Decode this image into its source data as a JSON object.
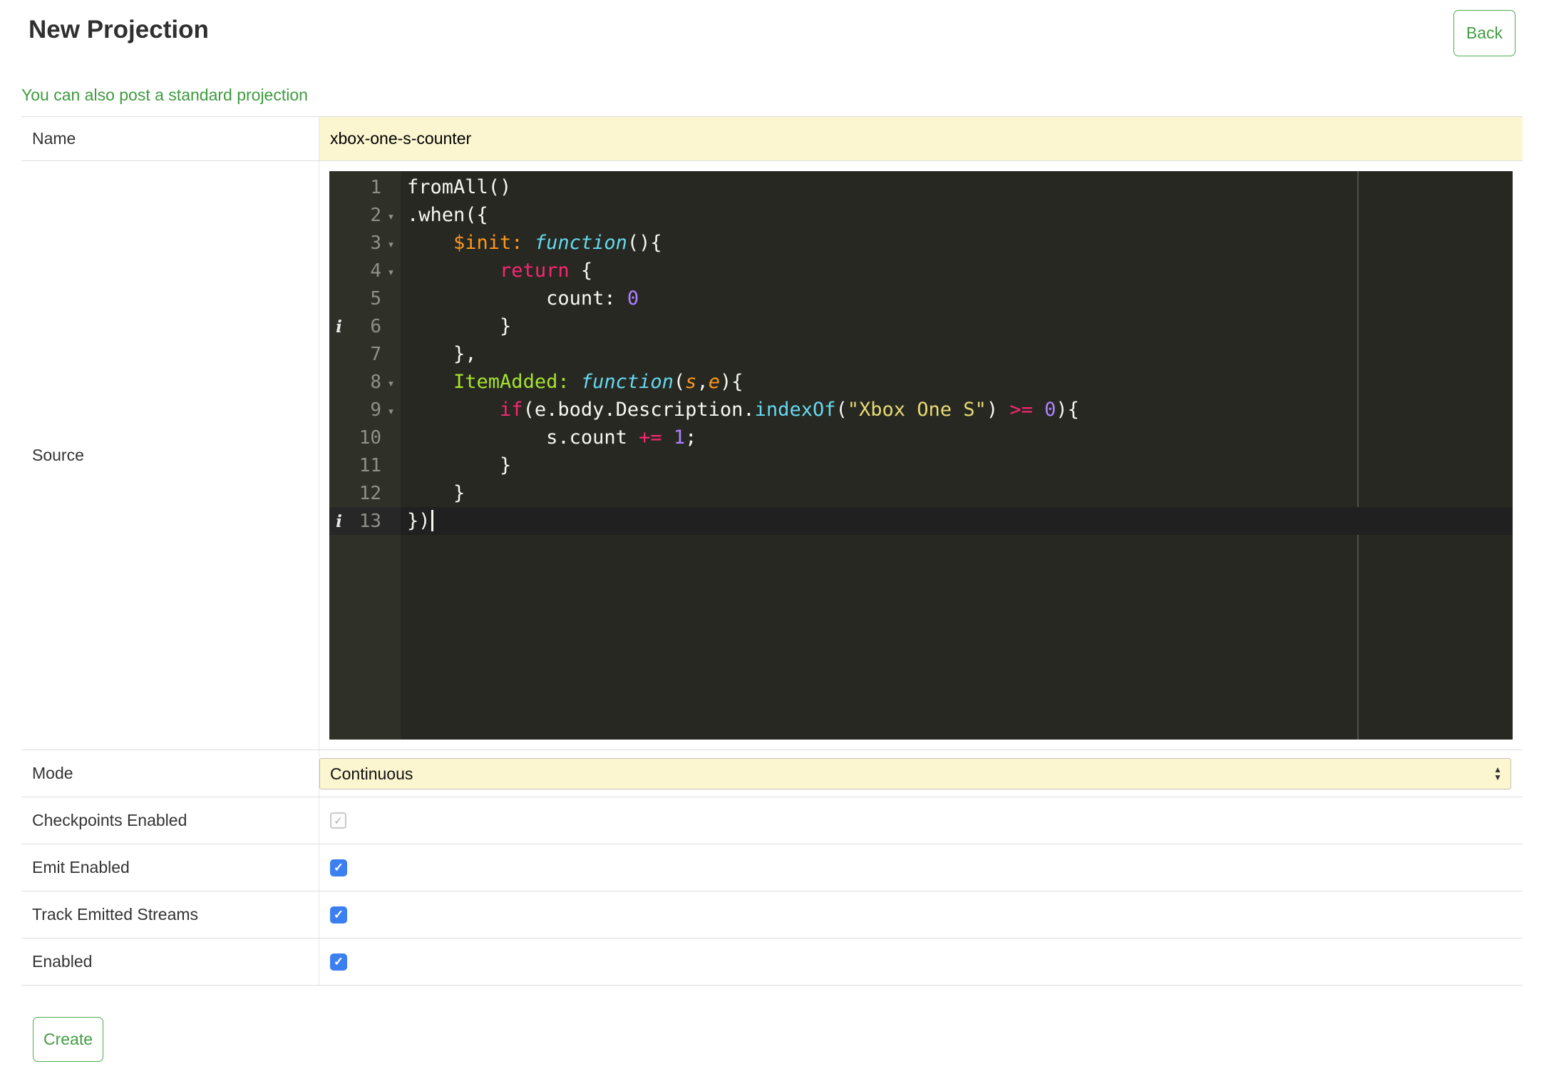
{
  "header": {
    "title": "New Projection",
    "back_label": "Back"
  },
  "link": {
    "text": "You can also post a standard projection"
  },
  "form": {
    "name": {
      "label": "Name",
      "value": "xbox-one-s-counter"
    },
    "source": {
      "label": "Source"
    },
    "mode": {
      "label": "Mode",
      "value": "Continuous"
    },
    "checkpoints": {
      "label": "Checkpoints Enabled",
      "checked": true,
      "disabled": true
    },
    "emit": {
      "label": "Emit Enabled",
      "checked": true,
      "disabled": false
    },
    "track": {
      "label": "Track Emitted Streams",
      "checked": true,
      "disabled": false
    },
    "enabled": {
      "label": "Enabled",
      "checked": true,
      "disabled": false
    },
    "create_label": "Create"
  },
  "colors": {
    "accent_green_text": "#449d44",
    "accent_green_border": "#4cae4c",
    "link_green": "#3e9b3e",
    "field_yellow": "#fbf6d0",
    "checkbox_blue": "#3b7ff0",
    "table_border": "#dddddd",
    "editor_background": "#272822",
    "editor_gutter_background": "#2f3129",
    "editor_active_line": "#202020",
    "editor_keyword": "#f92672",
    "editor_string": "#e6db74",
    "editor_number": "#ae81ff",
    "editor_function": "#66d9ef",
    "editor_entity": "#a6e22e",
    "editor_param": "#fd971f"
  },
  "editor": {
    "language": "javascript",
    "lines": [
      {
        "num": 1,
        "segments": [
          {
            "style": "plain",
            "text": "fromAll()"
          }
        ]
      },
      {
        "num": 2,
        "fold": true,
        "segments": [
          {
            "style": "plain",
            "text": ".when({"
          }
        ]
      },
      {
        "num": 3,
        "fold": true,
        "segments": [
          {
            "style": "plain",
            "text": "    "
          },
          {
            "style": "prop",
            "text": "$init:"
          },
          {
            "style": "plain",
            "text": " "
          },
          {
            "style": "fn",
            "text": "function"
          },
          {
            "style": "plain",
            "text": "(){"
          }
        ]
      },
      {
        "num": 4,
        "fold": true,
        "segments": [
          {
            "style": "plain",
            "text": "        "
          },
          {
            "style": "kw",
            "text": "return"
          },
          {
            "style": "plain",
            "text": " {"
          }
        ]
      },
      {
        "num": 5,
        "segments": [
          {
            "style": "plain",
            "text": "            count: "
          },
          {
            "style": "num",
            "text": "0"
          }
        ]
      },
      {
        "num": 6,
        "info": true,
        "segments": [
          {
            "style": "plain",
            "text": "        }"
          }
        ]
      },
      {
        "num": 7,
        "segments": [
          {
            "style": "plain",
            "text": "    },"
          }
        ]
      },
      {
        "num": 8,
        "fold": true,
        "segments": [
          {
            "style": "plain",
            "text": "    "
          },
          {
            "style": "ent",
            "text": "ItemAdded:"
          },
          {
            "style": "plain",
            "text": " "
          },
          {
            "style": "fn",
            "text": "function"
          },
          {
            "style": "plain",
            "text": "("
          },
          {
            "style": "arg",
            "text": "s"
          },
          {
            "style": "plain",
            "text": ","
          },
          {
            "style": "arg",
            "text": "e"
          },
          {
            "style": "plain",
            "text": "){"
          }
        ]
      },
      {
        "num": 9,
        "fold": true,
        "segments": [
          {
            "style": "plain",
            "text": "        "
          },
          {
            "style": "kw",
            "text": "if"
          },
          {
            "style": "plain",
            "text": "(e.body.Description."
          },
          {
            "style": "sup",
            "text": "indexOf"
          },
          {
            "style": "plain",
            "text": "("
          },
          {
            "style": "str",
            "text": "\"Xbox One S\""
          },
          {
            "style": "plain",
            "text": ") "
          },
          {
            "style": "kw",
            "text": ">="
          },
          {
            "style": "plain",
            "text": " "
          },
          {
            "style": "num",
            "text": "0"
          },
          {
            "style": "plain",
            "text": "){"
          }
        ]
      },
      {
        "num": 10,
        "segments": [
          {
            "style": "plain",
            "text": "            s.count "
          },
          {
            "style": "kw",
            "text": "+="
          },
          {
            "style": "plain",
            "text": " "
          },
          {
            "style": "num",
            "text": "1"
          },
          {
            "style": "plain",
            "text": ";"
          }
        ]
      },
      {
        "num": 11,
        "segments": [
          {
            "style": "plain",
            "text": "        }"
          }
        ]
      },
      {
        "num": 12,
        "segments": [
          {
            "style": "plain",
            "text": "    }"
          }
        ]
      },
      {
        "num": 13,
        "info": true,
        "active": true,
        "cursor": true,
        "segments": [
          {
            "style": "plain",
            "text": "})"
          }
        ]
      }
    ]
  }
}
